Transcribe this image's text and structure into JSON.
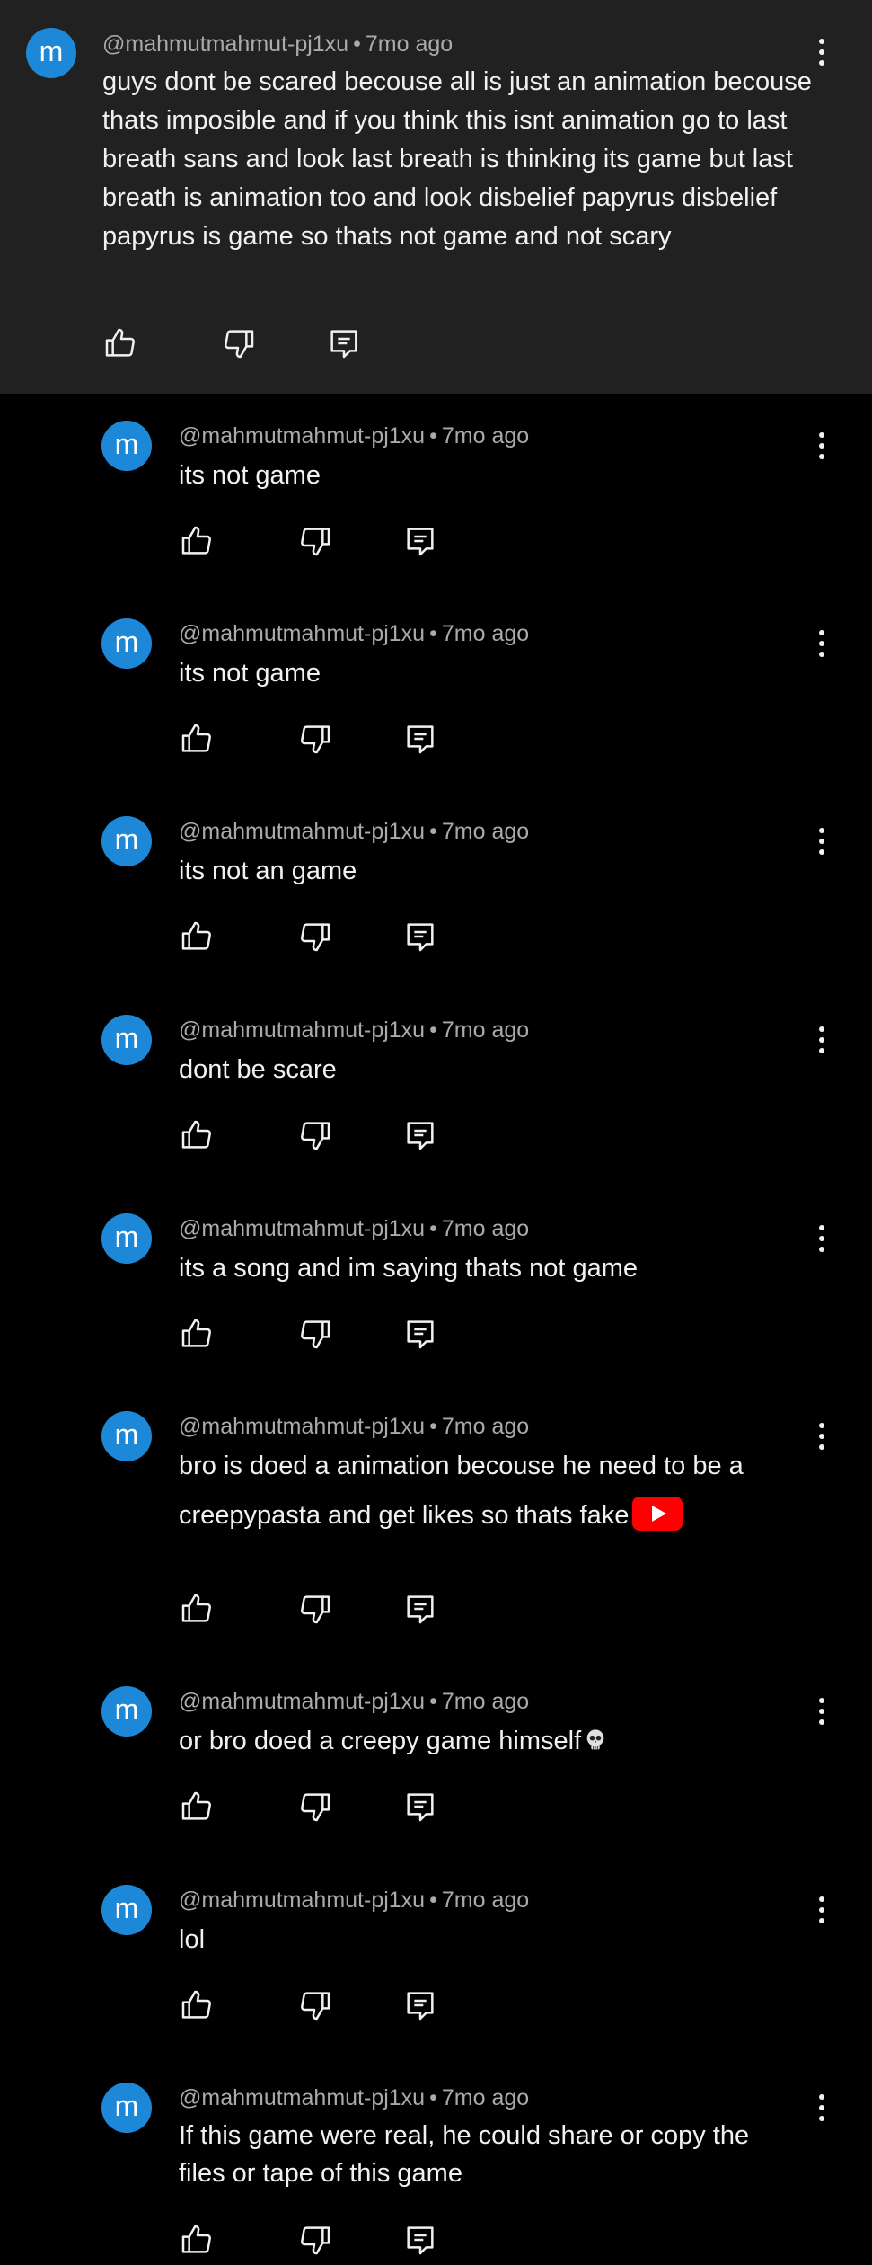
{
  "theme": {
    "background": "#000000",
    "parent_background": "#212121",
    "avatar_color": "#1e88d8",
    "meta_color": "#aaaaaa",
    "emoji_youtube_color": "#ff0000"
  },
  "parent": {
    "avatar_letter": "m",
    "author": "@mahmutmahmut-pj1xu",
    "separator": "•",
    "time": "7mo ago",
    "text": "guys dont be scared becouse all is just an animation becouse thats imposible and if you think this isnt animation go to last breath sans and look last breath is thinking its game but last breath is animation too and look disbelief papyrus disbelief papyrus is game so thats not game and not scary",
    "actions": [
      "like-icon",
      "dislike-icon",
      "reply-icon"
    ],
    "menu_icon": "more-vertical-icon"
  },
  "replies": [
    {
      "avatar_letter": "m",
      "author": "@mahmutmahmut-pj1xu",
      "separator": "•",
      "time": "7mo ago",
      "text": "its not game"
    },
    {
      "avatar_letter": "m",
      "author": "@mahmutmahmut-pj1xu",
      "separator": "•",
      "time": "7mo ago",
      "text": "its not game"
    },
    {
      "avatar_letter": "m",
      "author": "@mahmutmahmut-pj1xu",
      "separator": "•",
      "time": "7mo ago",
      "text": "its not an game"
    },
    {
      "avatar_letter": "m",
      "author": "@mahmutmahmut-pj1xu",
      "separator": "•",
      "time": "7mo ago",
      "text": "dont be scare"
    },
    {
      "avatar_letter": "m",
      "author": "@mahmutmahmut-pj1xu",
      "separator": "•",
      "time": "7mo ago",
      "text": "its a song and im saying thats not game"
    },
    {
      "avatar_letter": "m",
      "author": "@mahmutmahmut-pj1xu",
      "separator": "•",
      "time": "7mo ago",
      "text": "bro is doed a animation becouse he need to be a creepypasta and get likes so thats fake",
      "emoji": "youtube-logo-emoji"
    },
    {
      "avatar_letter": "m",
      "author": "@mahmutmahmut-pj1xu",
      "separator": "•",
      "time": "7mo ago",
      "text": "or bro doed a creepy game himself",
      "emoji": "skull-emoji"
    },
    {
      "avatar_letter": "m",
      "author": "@mahmutmahmut-pj1xu",
      "separator": "•",
      "time": "7mo ago",
      "text": "lol"
    },
    {
      "avatar_letter": "m",
      "author": "@mahmutmahmut-pj1xu",
      "separator": "•",
      "time": "7mo ago",
      "text": "If this game were real, he could share or copy the files or tape of this game"
    }
  ]
}
